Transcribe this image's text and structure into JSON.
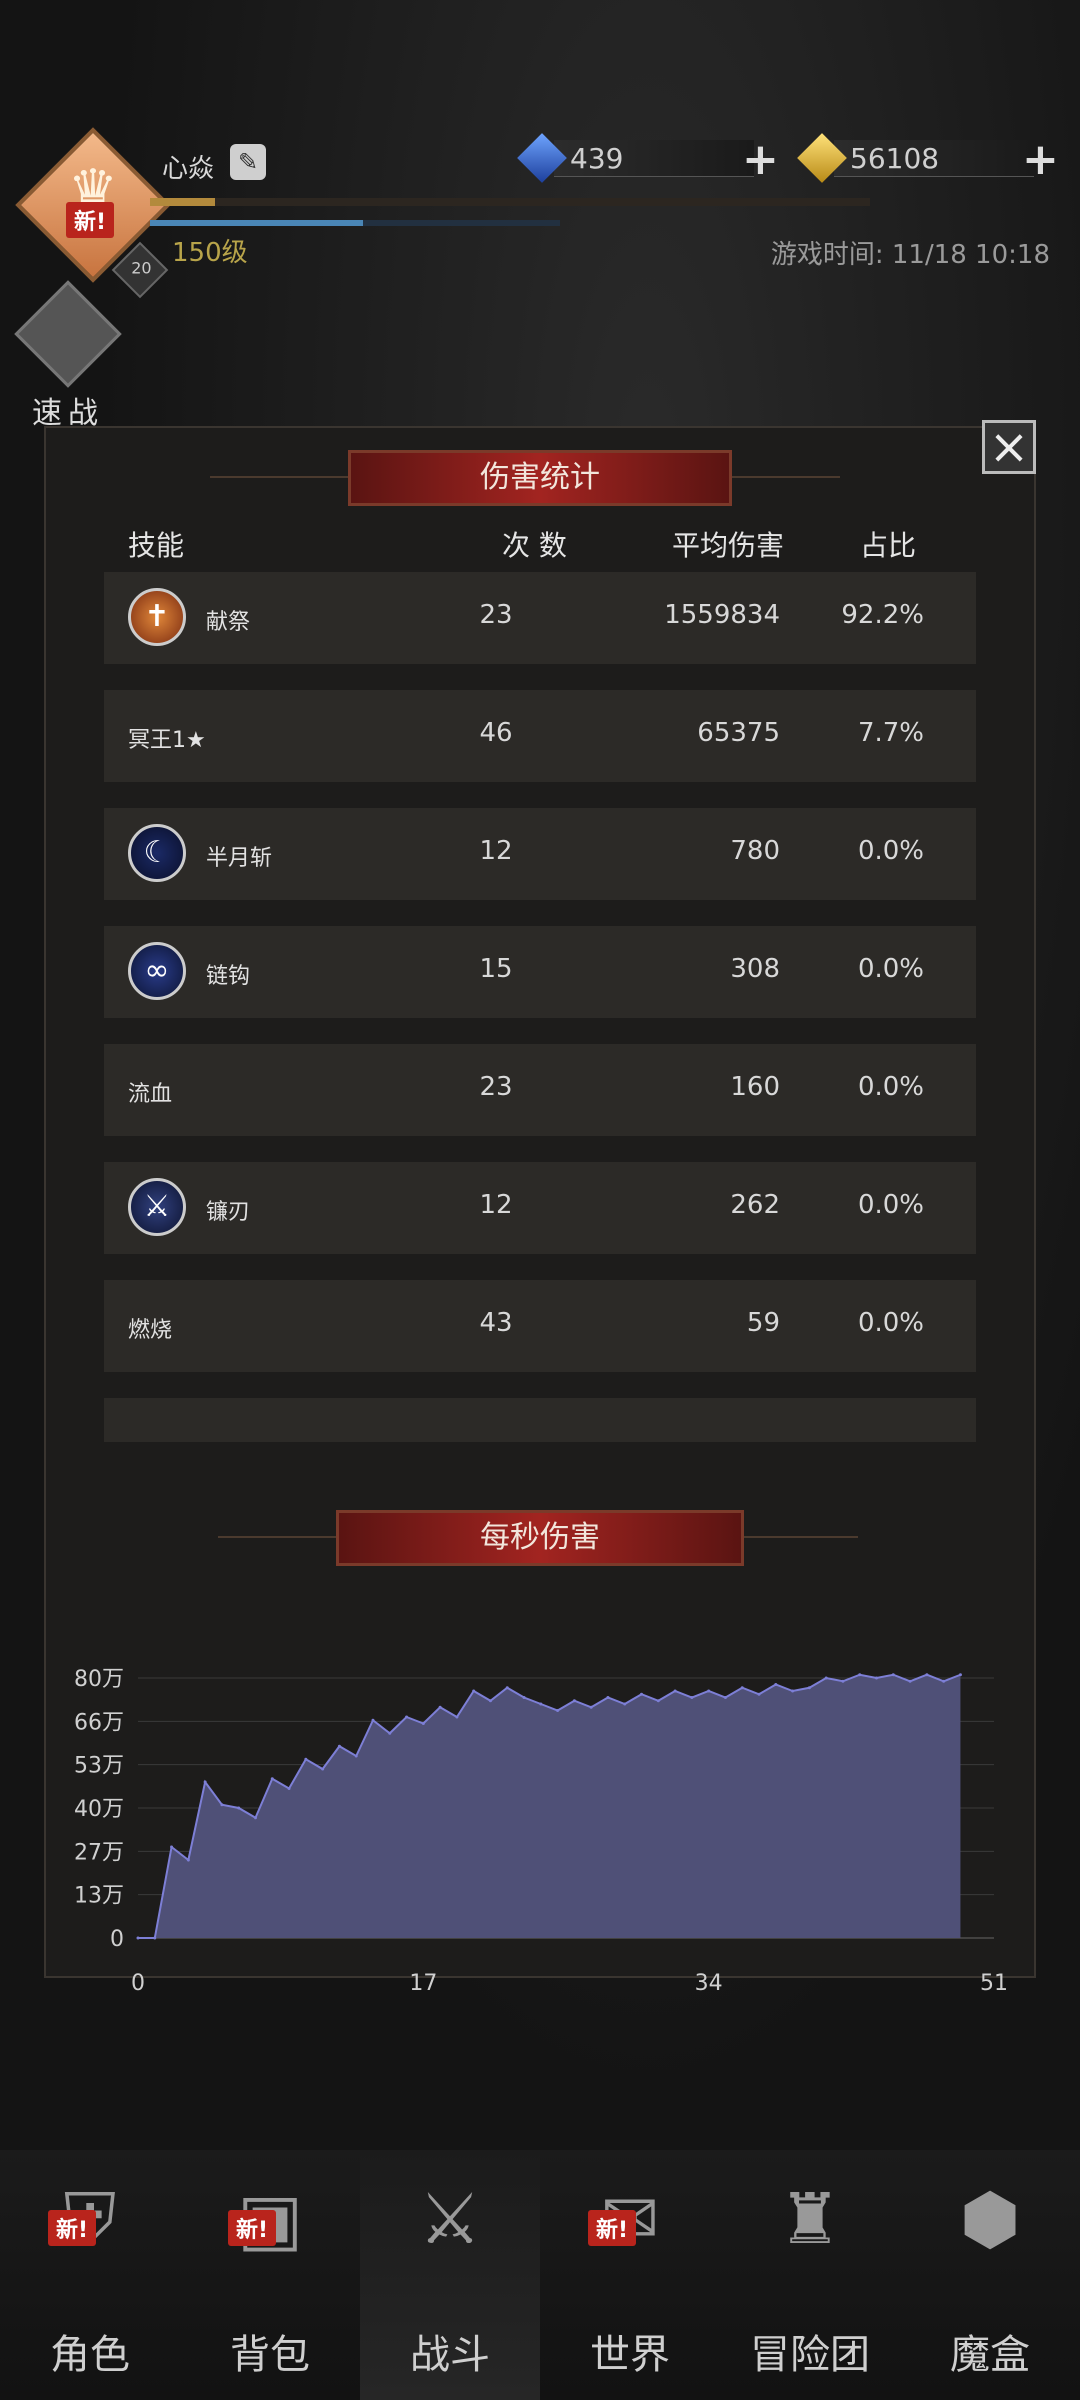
{
  "header": {
    "player_name": "心焱",
    "level": "150级",
    "avatar_badge": "新!",
    "avatar_rank": "20",
    "exp_progress": 0.09,
    "hp_progress": 0.52,
    "gems": "439",
    "gold": "56108",
    "game_time": "游戏时间: 11/18 10:18",
    "quick_battle": "速战"
  },
  "panel": {
    "title": "伤害统计",
    "columns": {
      "skill": "技能",
      "count": "次 数",
      "avg": "平均伤害",
      "share": "占比"
    },
    "rows": [
      {
        "name": "献祭",
        "count": "23",
        "avg": "1559834",
        "share": "92.2%",
        "icon": "sacrifice-icon"
      },
      {
        "name": "冥王1★",
        "count": "46",
        "avg": "65375",
        "share": "7.7%",
        "icon": ""
      },
      {
        "name": "半月斩",
        "count": "12",
        "avg": "780",
        "share": "0.0%",
        "icon": "crescent-moon-icon"
      },
      {
        "name": "链钩",
        "count": "15",
        "avg": "308",
        "share": "0.0%",
        "icon": "chain-hook-icon"
      },
      {
        "name": "流血",
        "count": "23",
        "avg": "160",
        "share": "0.0%",
        "icon": ""
      },
      {
        "name": "镰刃",
        "count": "12",
        "avg": "262",
        "share": "0.0%",
        "icon": "sickle-blade-icon"
      },
      {
        "name": "燃烧",
        "count": "43",
        "avg": "59",
        "share": "0.0%",
        "icon": ""
      },
      {
        "name": "",
        "count": "",
        "avg": "",
        "share": "",
        "icon": ""
      }
    ],
    "close_label": "×"
  },
  "chart_data": {
    "type": "area",
    "title": "每秒伤害",
    "xlabel": "",
    "ylabel": "",
    "x_ticks": [
      "0",
      "17",
      "34",
      "51"
    ],
    "y_ticks": [
      "0",
      "13万",
      "27万",
      "40万",
      "53万",
      "66万",
      "80万"
    ],
    "xlim": [
      0,
      51
    ],
    "ylim": [
      0,
      80
    ],
    "y_unit": "万",
    "fill_color": "#4f5077",
    "line_color": "#7d7fd6",
    "x": [
      0,
      1,
      2,
      3,
      4,
      5,
      6,
      7,
      8,
      9,
      10,
      11,
      12,
      13,
      14,
      15,
      16,
      17,
      18,
      19,
      20,
      21,
      22,
      23,
      24,
      25,
      26,
      27,
      28,
      29,
      30,
      31,
      32,
      33,
      34,
      35,
      36,
      37,
      38,
      39,
      40,
      41,
      42,
      43,
      44,
      45,
      46,
      47,
      48,
      49
    ],
    "values": [
      0,
      0,
      28,
      24,
      48,
      41,
      40,
      37,
      49,
      46,
      55,
      52,
      59,
      56,
      67,
      63,
      68,
      66,
      71,
      68,
      76,
      73,
      77,
      74,
      72,
      70,
      73,
      71,
      74,
      72,
      75,
      73,
      76,
      74,
      76,
      74,
      77,
      75,
      78,
      76,
      77,
      80,
      79,
      81,
      80,
      81,
      79,
      81,
      79,
      81
    ]
  },
  "nav": [
    {
      "label": "角色",
      "badge": "新!"
    },
    {
      "label": "背包",
      "badge": "新!"
    },
    {
      "label": "战斗",
      "badge": "",
      "active": true
    },
    {
      "label": "世界",
      "badge": "新!"
    },
    {
      "label": "冒险团",
      "badge": ""
    },
    {
      "label": "魔盒",
      "badge": ""
    }
  ]
}
